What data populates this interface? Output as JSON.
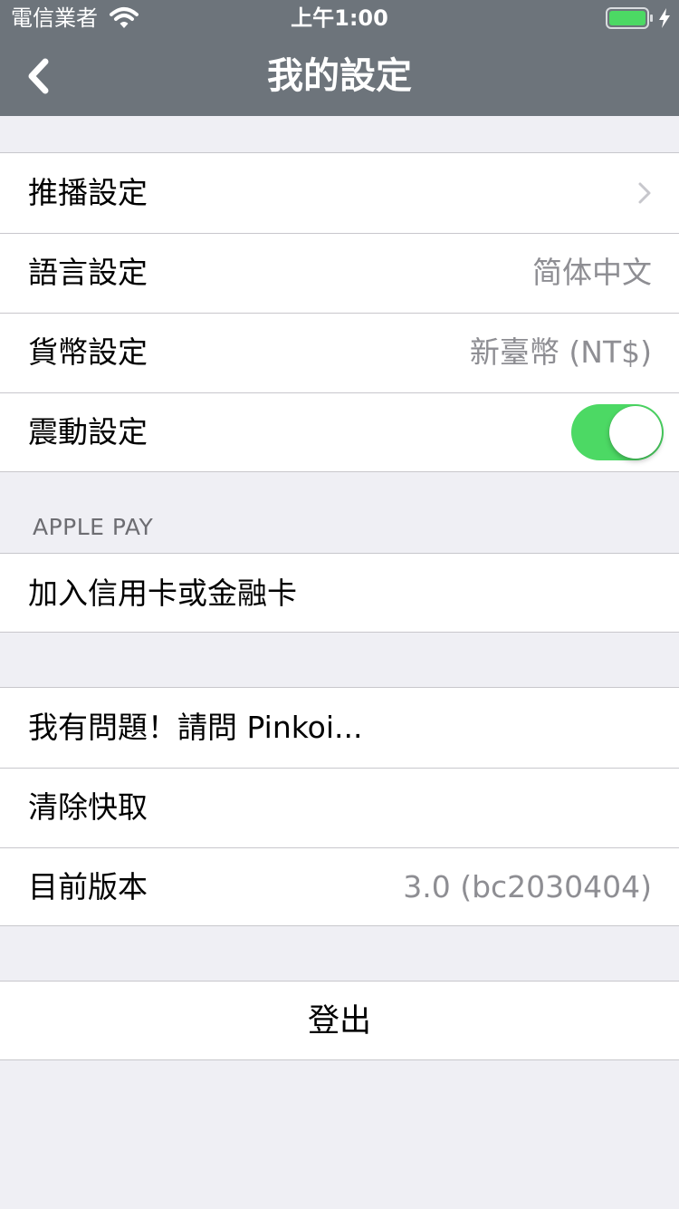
{
  "status_bar": {
    "carrier": "電信業者",
    "time": "上午1:00",
    "wifi_icon": "wifi-icon",
    "battery_icon": "battery-full-icon",
    "charging_icon": "charging-bolt-icon"
  },
  "nav": {
    "back_icon": "chevron-left-icon",
    "title": "我的設定"
  },
  "settings": {
    "push": {
      "label": "推播設定",
      "icon": "chevron-right-icon"
    },
    "language": {
      "label": "語言設定",
      "value": "简体中文"
    },
    "currency": {
      "label": "貨幣設定",
      "value": "新臺幣 (NT$)"
    },
    "vibration": {
      "label": "震動設定",
      "enabled": true
    }
  },
  "apple_pay": {
    "header": "APPLE PAY",
    "add_card": "加入信用卡或金融卡"
  },
  "support": {
    "ask": "我有問題！請問 Pinkoi...",
    "clear_cache": "清除快取",
    "version_label": "目前版本",
    "version_value": "3.0 (bc2030404)"
  },
  "logout": {
    "label": "登出"
  },
  "colors": {
    "nav_background": "#6d747b",
    "page_background": "#efeff4",
    "toggle_on": "#4cd964",
    "battery": "#4cd964",
    "secondary_text": "#8e8e93"
  }
}
